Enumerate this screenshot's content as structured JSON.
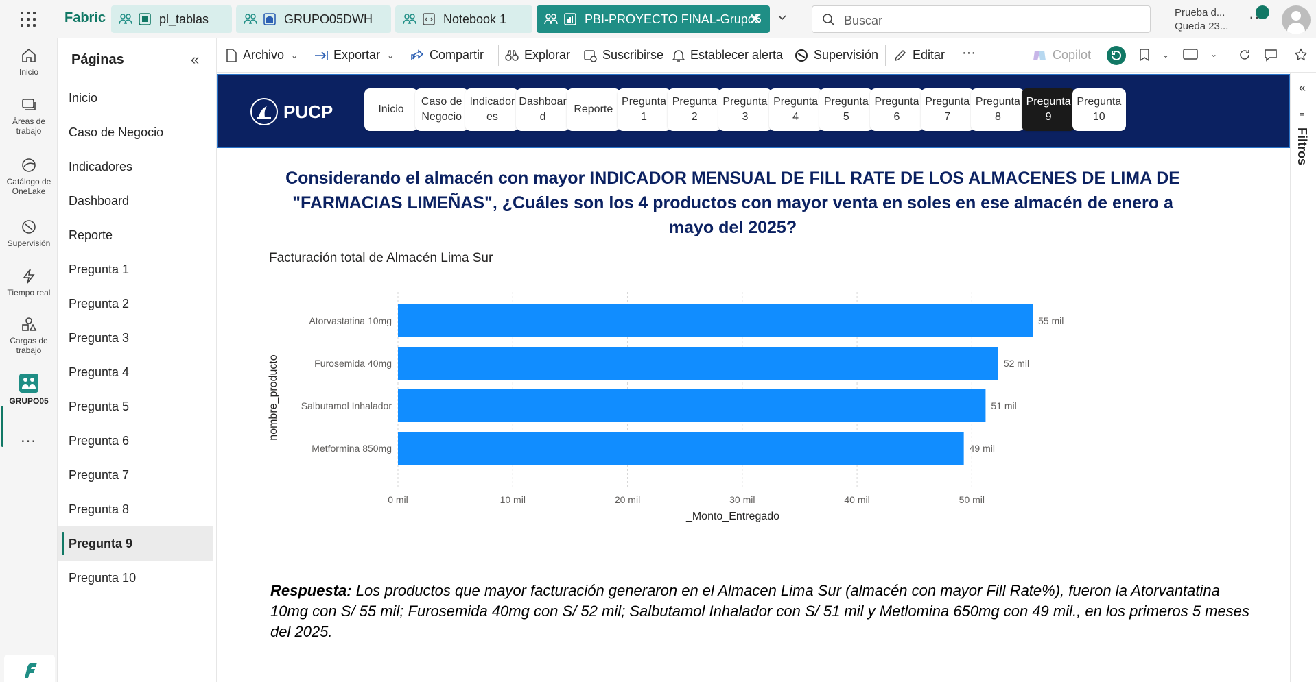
{
  "app": {
    "brand": "Fabric",
    "tabs": [
      {
        "label": "pl_tablas",
        "icon": "pipeline-icon"
      },
      {
        "label": "GRUPO05DWH",
        "icon": "warehouse-icon"
      },
      {
        "label": "Notebook 1",
        "icon": "notebook-icon"
      },
      {
        "label": "PBI-PROYECTO FINAL-Grupo5",
        "icon": "report-icon",
        "active": true
      }
    ],
    "search_placeholder": "Buscar",
    "trial_line1": "Prueba d...",
    "trial_line2": "Queda 23..."
  },
  "rail": {
    "items": [
      "Inicio",
      "Áreas de trabajo",
      "Catálogo de OneLake",
      "Supervisión",
      "Tiempo real",
      "Cargas de trabajo",
      "GRUPO05"
    ],
    "more": "..."
  },
  "pages": {
    "title": "Páginas",
    "collapse": "«",
    "items": [
      "Inicio",
      "Caso de Negocio",
      "Indicadores",
      "Dashboard",
      "Reporte",
      "Pregunta 1",
      "Pregunta 2",
      "Pregunta 3",
      "Pregunta 4",
      "Pregunta 5",
      "Pregunta 6",
      "Pregunta 7",
      "Pregunta 8",
      "Pregunta 9",
      "Pregunta 10"
    ],
    "active_index": 13
  },
  "toolbar": {
    "archivo": "Archivo",
    "exportar": "Exportar",
    "compartir": "Compartir",
    "explorar": "Explorar",
    "suscribirse": "Suscribirse",
    "alerta": "Establecer alerta",
    "supervision": "Supervisión",
    "editar": "Editar",
    "more": "···",
    "copilot": "Copilot"
  },
  "report": {
    "logo_text": "PUCP",
    "nav": [
      "Inicio",
      "Caso de Negocio",
      "Indicadores",
      "Dashboard",
      "Reporte",
      "Pregunta 1",
      "Pregunta 2",
      "Pregunta 3",
      "Pregunta 4",
      "Pregunta 5",
      "Pregunta 6",
      "Pregunta 7",
      "Pregunta 8",
      "Pregunta 9",
      "Pregunta 10"
    ],
    "nav_active_index": 13,
    "question": "Considerando el almacén con mayor INDICADOR MENSUAL DE FILL RATE DE LOS ALMACENES DE LIMA DE \"FARMACIAS LIMEÑAS\", ¿Cuáles son los 4 productos con mayor venta en soles en ese almacén de enero a mayo del 2025?",
    "answer_label": "Respuesta:",
    "answer_text": " Los productos que mayor facturación generaron en el Almacen Lima Sur (almacén con mayor Fill Rate%), fueron la Atorvantatina 10mg con S/ 55 mil; Furosemida 40mg con S/ 52 mil; Salbutamol Inhalador con S/ 51 mil y Metlomina 650mg con 49 mil., en los primeros 5 meses del 2025."
  },
  "filters": {
    "label": "Filtros"
  },
  "chart_data": {
    "type": "bar",
    "orientation": "horizontal",
    "title": "Facturación total de Almacén Lima Sur",
    "xlabel": "_Monto_Entregado",
    "ylabel": "nombre_producto",
    "categories": [
      "Atorvastatina 10mg",
      "Furosemida 40mg",
      "Salbutamol Inhalador",
      "Metformina 850mg"
    ],
    "values": [
      55300,
      52300,
      51200,
      49300
    ],
    "data_labels": [
      "55 mil",
      "52 mil",
      "51 mil",
      "49 mil"
    ],
    "xticks": [
      0,
      10000,
      20000,
      30000,
      40000,
      50000
    ],
    "xtick_labels": [
      "0 mil",
      "10 mil",
      "20 mil",
      "30 mil",
      "40 mil",
      "50 mil"
    ],
    "xlim": [
      0,
      55300
    ],
    "grid": true,
    "bar_color": "#118DFF"
  }
}
